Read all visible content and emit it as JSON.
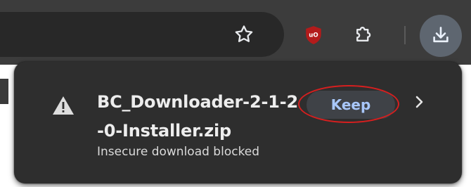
{
  "toolbar": {
    "bookmark_icon": "star-outline-icon",
    "extension_badge_icon": "ublock-origin-icon",
    "extensions_icon": "puzzle-piece-icon",
    "downloads_icon": "download-arrow-icon"
  },
  "download_bubble": {
    "file_name": "BC_Downloader-2-1-2-0-Installer.zip",
    "status": "Insecure download blocked",
    "keep_label": "Keep",
    "warning_icon": "warning-triangle-icon",
    "more_icon": "chevron-right-icon"
  },
  "colors": {
    "toolbar_bg": "#3c3c3c",
    "omnibox_bg": "#282828",
    "bubble_bg": "#2e2e2e",
    "keep_text": "#a8c7fa",
    "annotation": "#d61f1f",
    "ublock_red": "#b31b1b"
  }
}
